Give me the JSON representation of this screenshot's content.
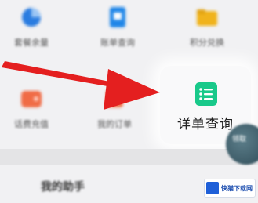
{
  "grid": {
    "items": [
      {
        "label": "套餐余量",
        "icon": "pie-chart-icon",
        "color": "#2a7ce0"
      },
      {
        "label": "账单查询",
        "icon": "bill-icon",
        "color": "#1f86e8"
      },
      {
        "label": "积分兑换",
        "icon": "folder-icon",
        "color": "#f0b31c"
      },
      {
        "label": "话费充值",
        "icon": "wallet-icon",
        "color": "#f06b45"
      },
      {
        "label": "我的订单",
        "icon": "order-icon",
        "color": "#f0724a"
      },
      {
        "label": "详单查询",
        "icon": "list-icon",
        "color": "#19c98a"
      }
    ]
  },
  "section": {
    "title": "我的助手"
  },
  "float_button": {
    "label": "领取"
  },
  "watermark": {
    "text": "快猫下载网"
  },
  "annotation": {
    "arrow_color": "#e41f1f"
  }
}
